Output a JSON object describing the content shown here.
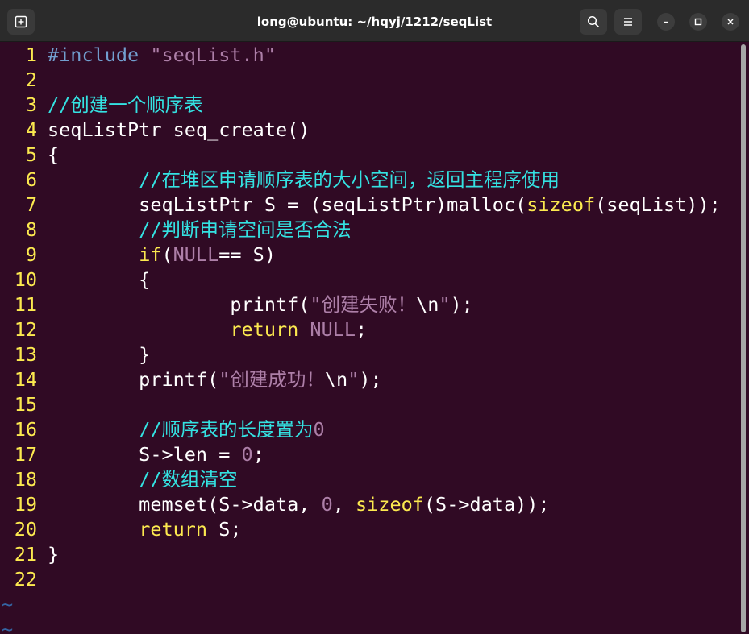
{
  "window": {
    "title": "long@ubuntu: ~/hqyj/1212/seqList",
    "buttons": [
      "new-tab-icon",
      "search-icon",
      "hamburger-menu-icon",
      "minimize-icon",
      "maximize-icon",
      "close-icon"
    ]
  },
  "colors": {
    "background": "#300a24",
    "line_number": "#fce94f",
    "comment": "#34e2e2",
    "preproc": "#729fcf",
    "string": "#ad7fa8",
    "keyword": "#fce94f",
    "number": "#ad7fa8",
    "text": "#ffffff",
    "tilde": "#3465a4"
  },
  "lines": [
    {
      "n": "1",
      "tokens": [
        {
          "t": "#include ",
          "c": "preproc"
        },
        {
          "t": "\"seqList.h\"",
          "c": "string"
        }
      ]
    },
    {
      "n": "2",
      "tokens": []
    },
    {
      "n": "3",
      "tokens": [
        {
          "t": "//创建一个顺序表",
          "c": "comment"
        }
      ]
    },
    {
      "n": "4",
      "tokens": [
        {
          "t": "seqListPtr seq_create()",
          "c": "text"
        }
      ]
    },
    {
      "n": "5",
      "tokens": [
        {
          "t": "{",
          "c": "text"
        }
      ]
    },
    {
      "n": "6",
      "tokens": [
        {
          "t": "        ",
          "c": "text"
        },
        {
          "t": "//在堆区申请顺序表的大小空间，返回主程序使用",
          "c": "comment"
        }
      ]
    },
    {
      "n": "7",
      "tokens": [
        {
          "t": "        seqListPtr S = (seqListPtr)malloc(",
          "c": "text"
        },
        {
          "t": "sizeof",
          "c": "keyword"
        },
        {
          "t": "(seqList));",
          "c": "text"
        }
      ]
    },
    {
      "n": "8",
      "tokens": [
        {
          "t": "        ",
          "c": "text"
        },
        {
          "t": "//判断申请空间是否合法",
          "c": "comment"
        }
      ]
    },
    {
      "n": "9",
      "tokens": [
        {
          "t": "        ",
          "c": "text"
        },
        {
          "t": "if",
          "c": "keyword"
        },
        {
          "t": "(",
          "c": "text"
        },
        {
          "t": "NULL",
          "c": "number"
        },
        {
          "t": "== S)",
          "c": "text"
        }
      ]
    },
    {
      "n": "10",
      "tokens": [
        {
          "t": "        {",
          "c": "text"
        }
      ]
    },
    {
      "n": "11",
      "tokens": [
        {
          "t": "                printf(",
          "c": "text"
        },
        {
          "t": "\"创建失败！",
          "c": "string"
        },
        {
          "t": "\\n",
          "c": "text"
        },
        {
          "t": "\"",
          "c": "string"
        },
        {
          "t": ");",
          "c": "text"
        }
      ]
    },
    {
      "n": "12",
      "tokens": [
        {
          "t": "                ",
          "c": "text"
        },
        {
          "t": "return",
          "c": "keyword"
        },
        {
          "t": " ",
          "c": "text"
        },
        {
          "t": "NULL",
          "c": "number"
        },
        {
          "t": ";",
          "c": "text"
        }
      ]
    },
    {
      "n": "13",
      "tokens": [
        {
          "t": "        }",
          "c": "text"
        }
      ]
    },
    {
      "n": "14",
      "tokens": [
        {
          "t": "        printf(",
          "c": "text"
        },
        {
          "t": "\"创建成功！",
          "c": "string"
        },
        {
          "t": "\\n",
          "c": "text"
        },
        {
          "t": "\"",
          "c": "string"
        },
        {
          "t": ");",
          "c": "text"
        }
      ]
    },
    {
      "n": "15",
      "tokens": []
    },
    {
      "n": "16",
      "tokens": [
        {
          "t": "        ",
          "c": "text"
        },
        {
          "t": "//顺序表的长度置为",
          "c": "comment"
        },
        {
          "t": "0",
          "c": "number"
        }
      ]
    },
    {
      "n": "17",
      "tokens": [
        {
          "t": "        S->len = ",
          "c": "text"
        },
        {
          "t": "0",
          "c": "number"
        },
        {
          "t": ";",
          "c": "text"
        }
      ]
    },
    {
      "n": "18",
      "tokens": [
        {
          "t": "        ",
          "c": "text"
        },
        {
          "t": "//数组清空",
          "c": "comment"
        }
      ]
    },
    {
      "n": "19",
      "tokens": [
        {
          "t": "        memset(S->data, ",
          "c": "text"
        },
        {
          "t": "0",
          "c": "number"
        },
        {
          "t": ", ",
          "c": "text"
        },
        {
          "t": "sizeof",
          "c": "keyword"
        },
        {
          "t": "(S->data));",
          "c": "text"
        }
      ]
    },
    {
      "n": "20",
      "tokens": [
        {
          "t": "        ",
          "c": "text"
        },
        {
          "t": "return",
          "c": "keyword"
        },
        {
          "t": " S;",
          "c": "text"
        }
      ]
    },
    {
      "n": "21",
      "tokens": [
        {
          "t": "}",
          "c": "text"
        }
      ]
    },
    {
      "n": "22",
      "tokens": []
    }
  ],
  "tildes": [
    "~",
    "~"
  ]
}
